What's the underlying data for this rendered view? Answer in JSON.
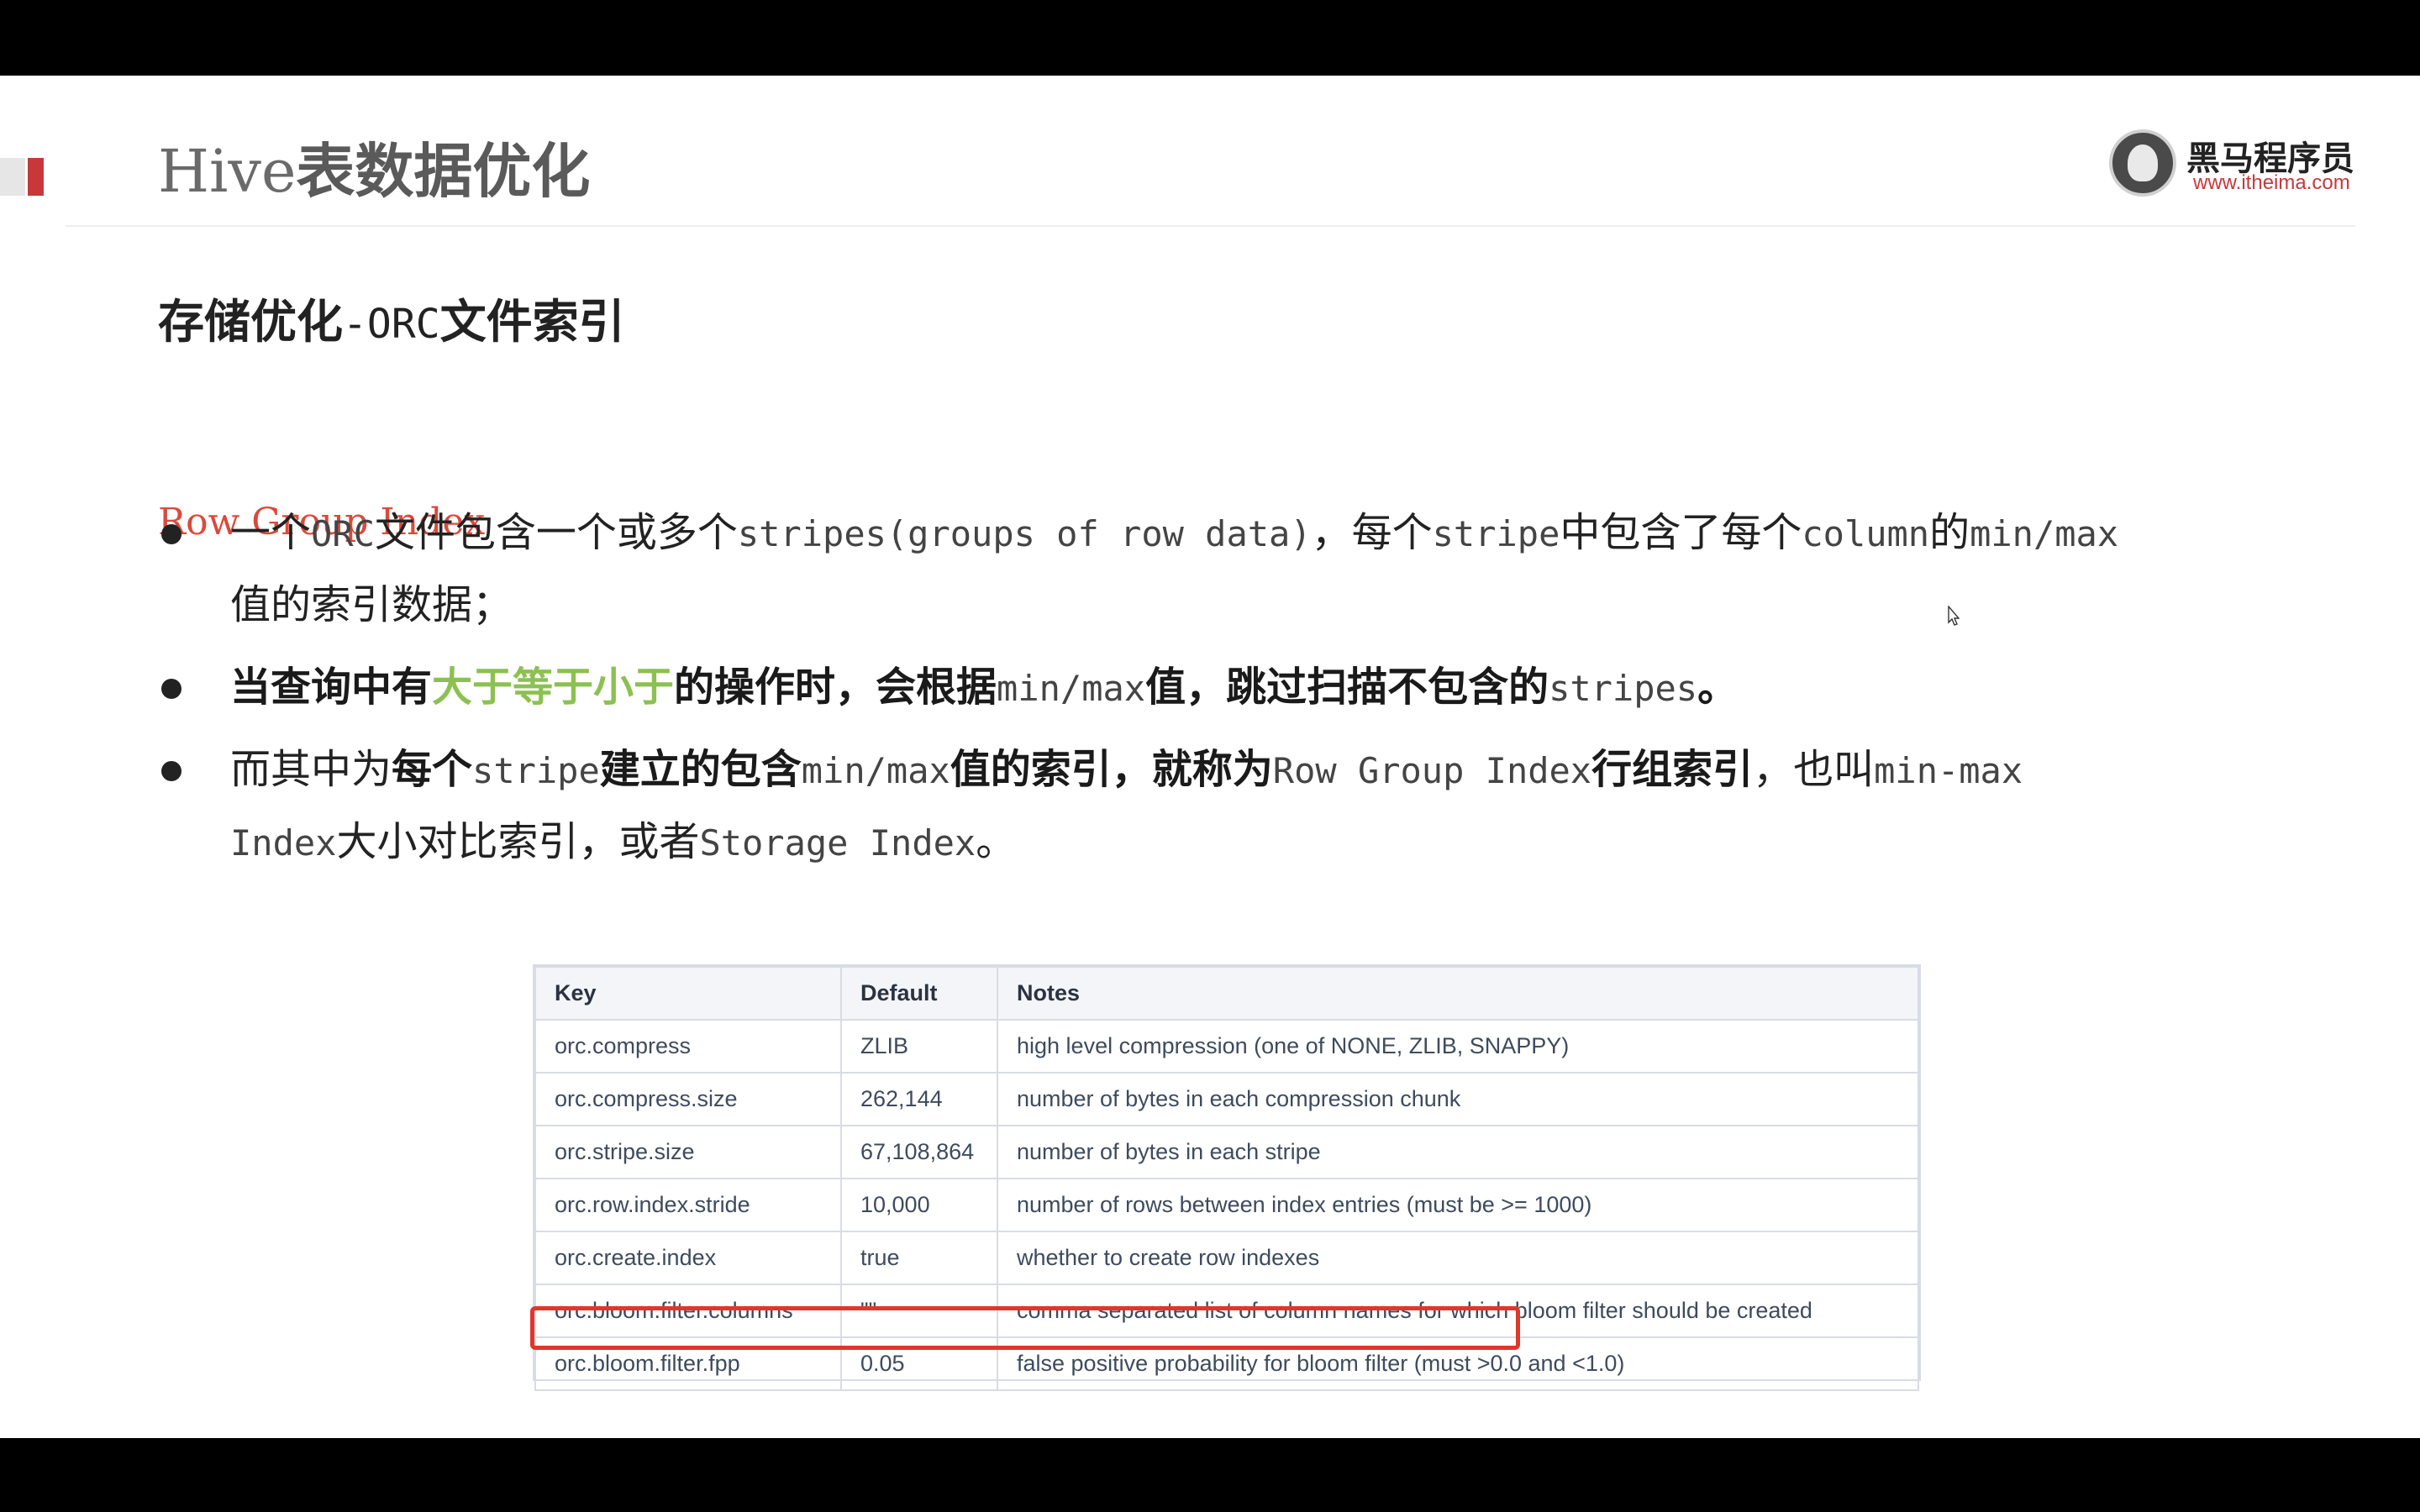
{
  "slide": {
    "title_latin": "Hive",
    "title_cn": "表数据优化",
    "subtitle": {
      "part1": "存储优化",
      "part2": "-ORC",
      "part3": "文件索引"
    },
    "section_heading": "Row Group Index"
  },
  "logo": {
    "name": "黑马程序员",
    "url": "www.itheima.com"
  },
  "bullets": [
    {
      "line1": [
        "一个",
        "ORC",
        "文件包含一个或多个",
        "stripes(groups of row data)",
        "，每个",
        "stripe",
        "中包含了每个",
        "column",
        "的",
        "min/max"
      ],
      "line2": "值的索引数据；"
    },
    {
      "line1": [
        "当查询中有",
        "大于等于小于",
        "的操作时，会根据",
        "min/max",
        "值，跳过扫描不包含的",
        "stripes",
        "。"
      ]
    },
    {
      "line1": [
        "而其中为",
        "每个",
        "stripe",
        "建立的包含",
        "min/max",
        "值的索引，就称为",
        "Row Group Index",
        "行组索引",
        "，也叫",
        "min-max"
      ],
      "line2": [
        "Index",
        "大小对比索引，或者",
        "Storage Index",
        "。"
      ]
    }
  ],
  "table": {
    "headers": [
      "Key",
      "Default",
      "Notes"
    ],
    "rows": [
      [
        "orc.compress",
        "ZLIB",
        "high level compression (one of NONE, ZLIB, SNAPPY)"
      ],
      [
        "orc.compress.size",
        "262,144",
        "number of bytes in each compression chunk"
      ],
      [
        "orc.stripe.size",
        "67,108,864",
        "number of bytes in each stripe"
      ],
      [
        "orc.row.index.stride",
        "10,000",
        "number of rows between index entries (must be >= 1000)"
      ],
      [
        "orc.create.index",
        "true",
        "whether to create row indexes"
      ],
      [
        "orc.bloom.filter.columns",
        "\"\"",
        "comma separated list of column names for which bloom filter should be created"
      ],
      [
        "orc.bloom.filter.fpp",
        "0.05",
        "false positive probability for bloom filter (must >0.0 and <1.0)"
      ]
    ],
    "highlighted_row": 4
  },
  "nav_controls": [
    {
      "icon": "prev-icon",
      "glyph": "◁"
    },
    {
      "icon": "next-icon",
      "glyph": "▷"
    },
    {
      "icon": "pen-icon",
      "glyph": "✎"
    },
    {
      "icon": "slides-icon",
      "glyph": "▦"
    },
    {
      "icon": "zoom-icon",
      "glyph": "⌕"
    },
    {
      "icon": "more-icon",
      "glyph": "⋯"
    }
  ],
  "progress": {
    "fraction": 0.887
  },
  "colors": {
    "accent_red": "#c8383a",
    "highlight_green": "#8cc152",
    "box_red": "#e1362b",
    "heading_red": "#d94a3b"
  }
}
